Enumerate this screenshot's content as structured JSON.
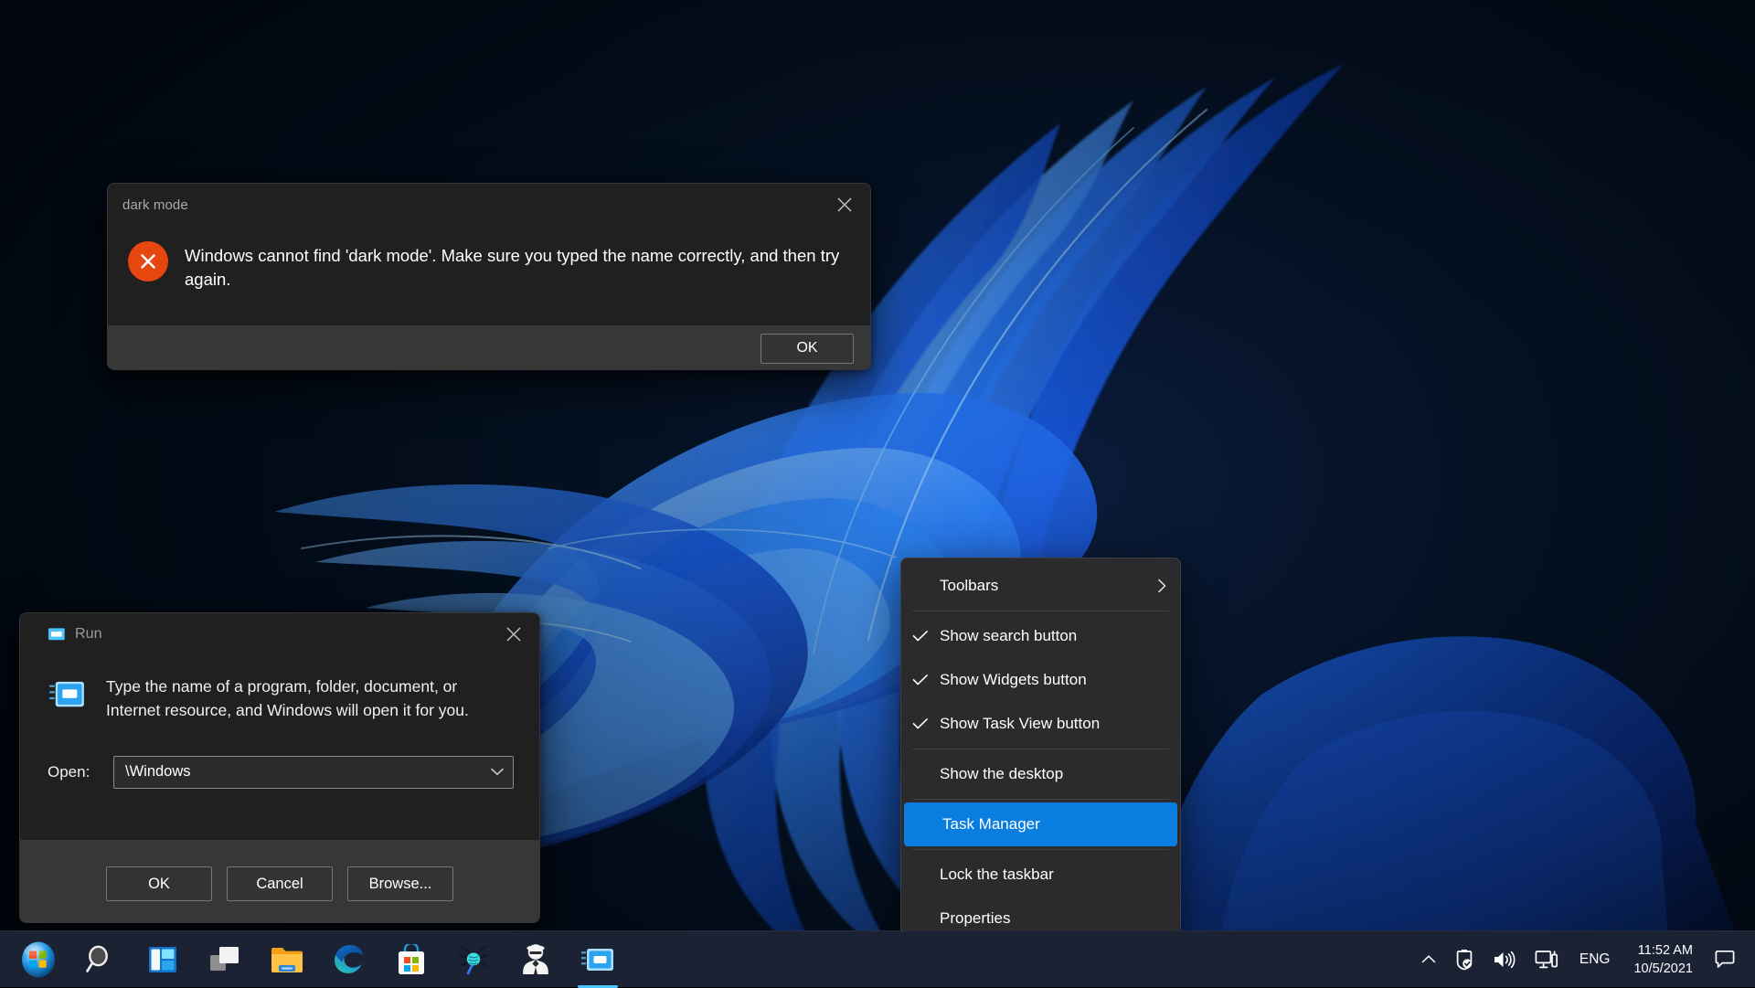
{
  "desktop": {
    "wallpaper_name": "windows-11-bloom-wallpaper",
    "bg_color": "#04101f",
    "accent_blue": "#1e6fff"
  },
  "error_dialog": {
    "title": "dark mode",
    "close_icon": "close-icon",
    "icon": "error-x-icon",
    "icon_color": "#E8460F",
    "message": "Windows cannot find 'dark mode'. Make sure you typed the name correctly, and then try again.",
    "ok_label": "OK"
  },
  "run_dialog": {
    "title": "Run",
    "title_icon": "run-window-icon",
    "close_icon": "close-icon",
    "description": "Type the name of a program, folder, document, or Internet resource, and Windows will open it for you.",
    "open_label": "Open:",
    "open_value": "\\Windows",
    "open_placeholder": "",
    "dropdown_icon": "chevron-down-icon",
    "buttons": [
      {
        "label": "OK",
        "name": "run-ok-button"
      },
      {
        "label": "Cancel",
        "name": "run-cancel-button"
      },
      {
        "label": "Browse...",
        "name": "run-browse-button"
      }
    ]
  },
  "context_menu": {
    "highlight_color": "#0a7ee0",
    "items": [
      {
        "label": "Toolbars",
        "checked": false,
        "submenu": true,
        "selected": false,
        "name": "menu-item-toolbars"
      },
      {
        "label": "Show search button",
        "checked": true,
        "submenu": false,
        "selected": false,
        "name": "menu-item-show-search-button"
      },
      {
        "label": "Show Widgets button",
        "checked": true,
        "submenu": false,
        "selected": false,
        "name": "menu-item-show-widgets-button"
      },
      {
        "label": "Show Task View button",
        "checked": true,
        "submenu": false,
        "selected": false,
        "name": "menu-item-show-task-view-button"
      },
      {
        "label": "Show the desktop",
        "checked": false,
        "submenu": false,
        "selected": false,
        "name": "menu-item-show-the-desktop"
      },
      {
        "label": "Task Manager",
        "checked": false,
        "submenu": false,
        "selected": true,
        "name": "menu-item-task-manager"
      },
      {
        "label": "Lock the taskbar",
        "checked": false,
        "submenu": false,
        "selected": false,
        "name": "menu-item-lock-the-taskbar"
      },
      {
        "label": "Properties",
        "checked": false,
        "submenu": false,
        "selected": false,
        "name": "menu-item-properties"
      }
    ]
  },
  "taskbar": {
    "bg_color": "#1b2233",
    "items": [
      {
        "icon": "start-windows-orb-icon",
        "name": "taskbar-start-button",
        "active": false
      },
      {
        "icon": "search-magnifier-icon",
        "name": "taskbar-search-button",
        "active": false
      },
      {
        "icon": "widgets-panel-icon",
        "name": "taskbar-widgets-button",
        "active": false
      },
      {
        "icon": "task-view-icon",
        "name": "taskbar-task-view-button",
        "active": false
      },
      {
        "icon": "file-explorer-folder-icon",
        "name": "taskbar-file-explorer",
        "active": false
      },
      {
        "icon": "microsoft-edge-icon",
        "name": "taskbar-microsoft-edge",
        "active": false
      },
      {
        "icon": "microsoft-store-icon",
        "name": "taskbar-microsoft-store",
        "active": false
      },
      {
        "icon": "spider-bug-icon",
        "name": "taskbar-bug-app",
        "active": false
      },
      {
        "icon": "incognito-spy-icon",
        "name": "taskbar-incognito-app",
        "active": false
      },
      {
        "icon": "run-window-icon",
        "name": "taskbar-run-dialog",
        "active": true
      }
    ],
    "tray": {
      "overflow_icon": "chevron-up-icon",
      "security_icon": "security-shield-check-icon",
      "volume_icon": "volume-speaker-icon",
      "network_icon": "network-monitor-icon",
      "language": "ENG",
      "time": "11:52 AM",
      "date": "10/5/2021",
      "chat_icon": "chat-bubble-icon"
    }
  }
}
